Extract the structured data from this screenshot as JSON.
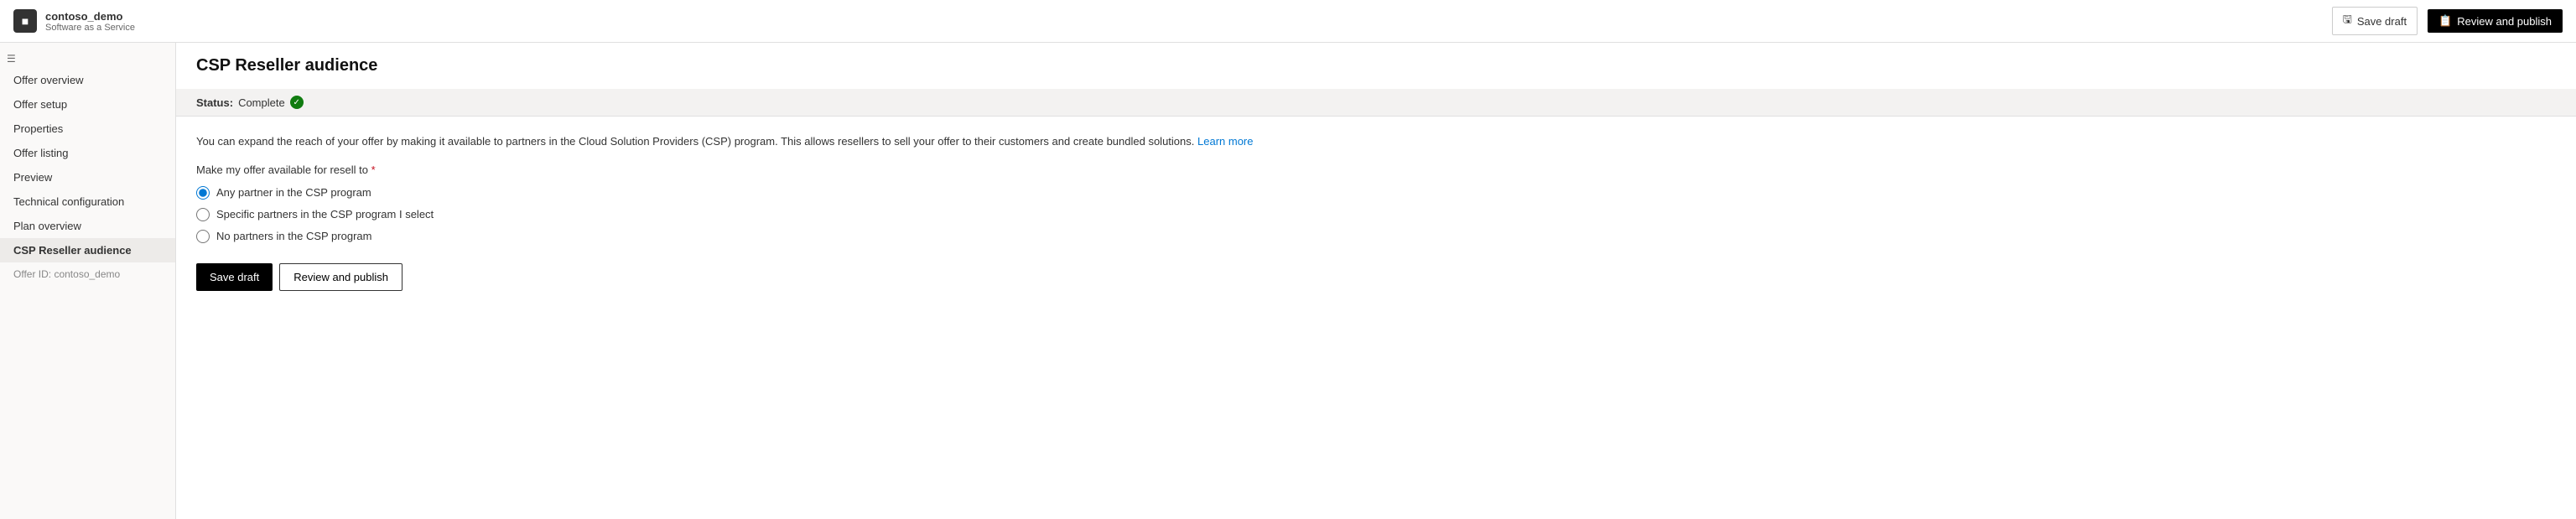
{
  "app": {
    "icon": "■",
    "name": "contoso_demo",
    "subtitle": "Software as a Service"
  },
  "topbar": {
    "save_draft_label": "Save draft",
    "review_publish_label": "Review and publish",
    "save_icon": "💾",
    "publish_icon": "📄"
  },
  "sidebar": {
    "items": [
      {
        "label": "Offer overview",
        "active": false
      },
      {
        "label": "Offer setup",
        "active": false
      },
      {
        "label": "Properties",
        "active": false
      },
      {
        "label": "Offer listing",
        "active": false
      },
      {
        "label": "Preview",
        "active": false
      },
      {
        "label": "Technical configuration",
        "active": false
      },
      {
        "label": "Plan overview",
        "active": false
      },
      {
        "label": "CSP Reseller audience",
        "active": true
      }
    ],
    "offer_id_label": "Offer ID: contoso_demo"
  },
  "page": {
    "title": "CSP Reseller audience",
    "status_label": "Status:",
    "status_value": "Complete",
    "description": "You can expand the reach of your offer by making it available to partners in the Cloud Solution Providers (CSP) program. This allows resellers to sell your offer to their customers and create bundled solutions.",
    "learn_more_label": "Learn more",
    "resell_label": "Make my offer available for resell to",
    "radio_options": [
      {
        "id": "any",
        "label": "Any partner in the CSP program",
        "checked": true
      },
      {
        "id": "specific",
        "label": "Specific partners in the CSP program I select",
        "checked": false
      },
      {
        "id": "none",
        "label": "No partners in the CSP program",
        "checked": false
      }
    ],
    "save_draft_label": "Save draft",
    "review_publish_label": "Review and publish"
  }
}
